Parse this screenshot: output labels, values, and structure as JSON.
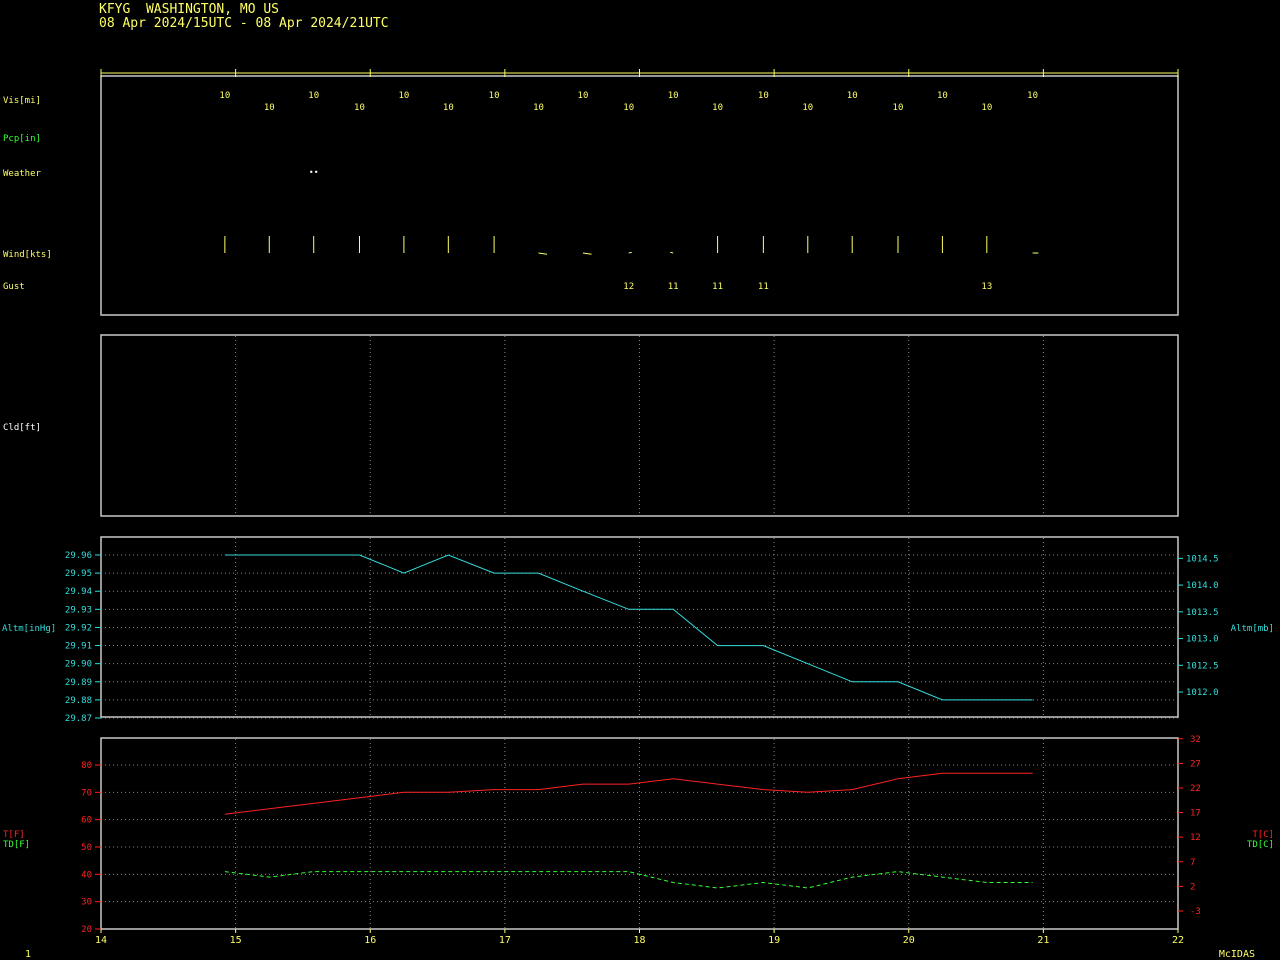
{
  "header": {
    "station_line": "KFYG  WASHINGTON, MO US",
    "period_line": "08 Apr 2024/15UTC - 08 Apr 2024/21UTC"
  },
  "colors": {
    "yellow": "#ffff66",
    "green": "#33ff33",
    "white": "#ffffff",
    "cyan": "#33dddd",
    "red": "#ff2222",
    "frame": "#c8c8c8",
    "grid": "#888888"
  },
  "labels": {
    "vis": "Vis[mi]",
    "pcp": "Pcp[in]",
    "weather": "Weather",
    "wind": "Wind[kts]",
    "gust": "Gust",
    "cld": "Cld[ft]",
    "altm_left": "Altm[inHg]",
    "altm_right": "Altm[mb]",
    "t_left": "T[F]",
    "td_left": "TD[F]",
    "t_right": "T[C]",
    "td_right": "TD[C]",
    "page_number": "1",
    "brand": "McIDAS"
  },
  "chart_data": {
    "type": "line",
    "x_axis": {
      "label": "",
      "range": [
        14,
        22
      ],
      "ticks": [
        "14",
        "15",
        "16",
        "17",
        "18",
        "19",
        "20",
        "21",
        "22"
      ]
    },
    "observation_hours": [
      14.92,
      15.25,
      15.58,
      15.92,
      16.25,
      16.58,
      16.92,
      17.25,
      17.58,
      17.92,
      18.25,
      18.58,
      18.92,
      19.25,
      19.58,
      19.92,
      20.25,
      20.58,
      20.92
    ],
    "visibility": [
      "10",
      "10",
      "10",
      "10",
      "10",
      "10",
      "10",
      "10",
      "10",
      "10",
      "10",
      "10",
      "10",
      "10",
      "10",
      "10",
      "10",
      "10",
      "10"
    ],
    "weather": [
      {
        "hour": 15.58,
        "symbol": "••"
      }
    ],
    "wind": [
      {
        "hour": 14.92,
        "dir": 360
      },
      {
        "hour": 15.25,
        "dir": 360
      },
      {
        "hour": 15.58,
        "dir": 360
      },
      {
        "hour": 15.92,
        "dir": 360
      },
      {
        "hour": 16.25,
        "dir": 360
      },
      {
        "hour": 16.58,
        "dir": 360
      },
      {
        "hour": 16.92,
        "dir": 360
      },
      {
        "hour": 17.25,
        "dir": 330
      },
      {
        "hour": 17.58,
        "dir": 330
      },
      {
        "hour": 17.92,
        "dir": 350
      },
      {
        "hour": 18.25,
        "dir": 10
      },
      {
        "hour": 18.58,
        "dir": 360
      },
      {
        "hour": 18.92,
        "dir": 360
      },
      {
        "hour": 19.25,
        "dir": 360
      },
      {
        "hour": 19.58,
        "dir": 360
      },
      {
        "hour": 19.92,
        "dir": 360
      },
      {
        "hour": 20.25,
        "dir": 360
      },
      {
        "hour": 20.58,
        "dir": 360
      },
      {
        "hour": 20.92,
        "dir": 340
      }
    ],
    "gusts": [
      {
        "hour": 17.92,
        "value": "12"
      },
      {
        "hour": 18.25,
        "value": "11"
      },
      {
        "hour": 18.58,
        "value": "11"
      },
      {
        "hour": 18.92,
        "value": "11"
      },
      {
        "hour": 20.58,
        "value": "13"
      }
    ],
    "altimeter": {
      "left_ticks": [
        "29.96",
        "29.95",
        "29.94",
        "29.93",
        "29.92",
        "29.91",
        "29.90",
        "29.89",
        "29.88",
        "29.87"
      ],
      "right_ticks": [
        "1014.5",
        "1014.0",
        "1013.5",
        "1013.0",
        "1012.5",
        "1012.0"
      ],
      "ylim_inhg": [
        29.87,
        29.97
      ],
      "series": {
        "x": [
          14.92,
          15.25,
          15.58,
          15.92,
          16.25,
          16.58,
          16.92,
          17.25,
          17.58,
          17.92,
          18.25,
          18.58,
          18.92,
          19.25,
          19.58,
          19.92,
          20.25,
          20.58,
          20.92
        ],
        "values": [
          29.96,
          29.96,
          29.96,
          29.96,
          29.95,
          29.96,
          29.95,
          29.95,
          29.94,
          29.93,
          29.93,
          29.91,
          29.91,
          29.9,
          29.89,
          29.89,
          29.88,
          29.88,
          29.88
        ]
      }
    },
    "temperature": {
      "left_ticks": [
        "20",
        "30",
        "40",
        "50",
        "60",
        "70",
        "80"
      ],
      "right_ticks": [
        "32",
        "27",
        "22",
        "17",
        "12",
        "7",
        "2",
        "-3"
      ],
      "ylim_f": [
        20,
        85
      ],
      "series": [
        {
          "x": [
            14.92,
            15.92,
            16.25,
            16.58,
            16.92,
            17.25,
            17.58,
            17.92,
            18.25,
            18.58,
            18.92,
            19.25,
            19.58,
            19.92,
            20.25,
            20.58,
            20.92
          ],
          "values": [
            62,
            68,
            70,
            70,
            71,
            71,
            73,
            73,
            75,
            73,
            71,
            70,
            71,
            75,
            77,
            77,
            77
          ]
        },
        {
          "x": [
            14.92,
            15.25,
            15.58,
            15.92,
            16.25,
            16.58,
            16.92,
            17.25,
            17.58,
            17.92,
            18.25,
            18.58,
            18.92,
            19.25,
            19.58,
            19.92,
            20.25,
            20.58,
            20.92
          ],
          "values": [
            41,
            39,
            41,
            41,
            41,
            41,
            41,
            41,
            41,
            41,
            37,
            35,
            37,
            35,
            39,
            41,
            39,
            37,
            37
          ]
        }
      ]
    }
  }
}
